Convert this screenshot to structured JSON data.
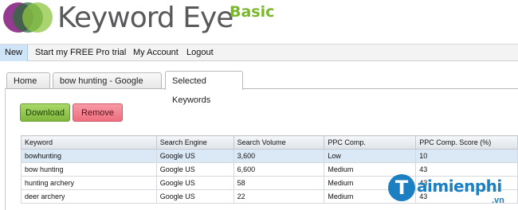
{
  "brand": {
    "name": "Keyword Eye",
    "edition": "Basic",
    "colors": {
      "purple": "#8e2f8a",
      "green_dark": "#2c6d3b",
      "green_light": "#8cc63f",
      "edition_green": "#7ab72f",
      "text_gray": "#58595b"
    }
  },
  "menu": {
    "items": [
      {
        "label": "New",
        "active": true
      },
      {
        "label": "Start my FREE Pro trial",
        "active": false
      },
      {
        "label": "My Account",
        "active": false
      },
      {
        "label": "Logout",
        "active": false
      }
    ]
  },
  "tabs": [
    {
      "label": "Home",
      "selected": false
    },
    {
      "label": "bow hunting - Google US",
      "selected": false
    },
    {
      "label": "Selected Keywords",
      "selected": true
    }
  ],
  "actions": {
    "download_label": "Download",
    "remove_label": "Remove"
  },
  "table": {
    "columns": [
      "Keyword",
      "Search Engine",
      "Search Volume",
      "PPC Comp.",
      "PPC Comp. Score (%)"
    ],
    "rows": [
      {
        "keyword": "bowhunting",
        "engine": "Google US",
        "volume": "3,600",
        "ppc": "Low",
        "score": "10",
        "selected": true
      },
      {
        "keyword": "bow hunting",
        "engine": "Google US",
        "volume": "6,600",
        "ppc": "Medium",
        "score": "43",
        "selected": false
      },
      {
        "keyword": "hunting archery",
        "engine": "Google US",
        "volume": "58",
        "ppc": "Medium",
        "score": "43",
        "selected": false
      },
      {
        "keyword": "deer archery",
        "engine": "Google US",
        "volume": "22",
        "ppc": "Medium",
        "score": "43",
        "selected": false
      }
    ]
  },
  "watermark": {
    "initial": "T",
    "text": "aimienphi",
    "suffix": ".vn"
  }
}
